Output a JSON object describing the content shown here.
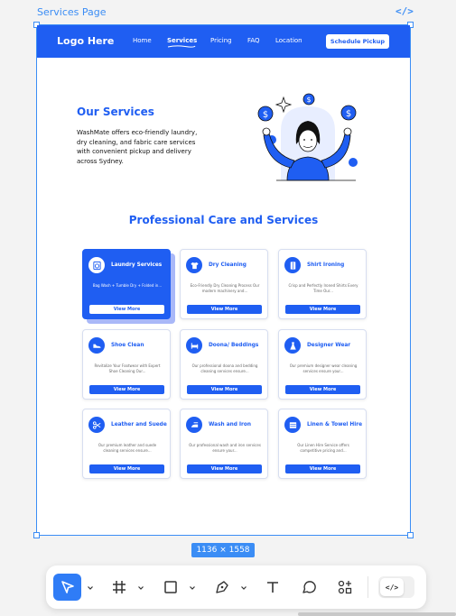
{
  "frame": {
    "label": "Services Page",
    "dev_icon": "</>",
    "size_badge": "1136 × 1558"
  },
  "site": {
    "logo": "Logo Here",
    "nav": [
      "Home",
      "Services",
      "Pricing",
      "FAQ",
      "Location"
    ],
    "active_nav": "Services",
    "cta": "Schedule Pickup",
    "hero_title": "Our Services",
    "hero_text": "WashMate offers eco-friendly laundry, dry cleaning, and fabric care services with convenient pickup and delivery across Sydney.",
    "section_title": "Professional Care and Services",
    "button_label": "View More",
    "services": [
      {
        "title": "Laundry Services",
        "desc": "Bag Wash + Tumble Dry + Folded in...",
        "icon": "laundry-icon",
        "active": true
      },
      {
        "title": "Dry Cleaning",
        "desc": "Eco-Friendly Dry Cleaning Process Our modern machinery and...",
        "icon": "shirt-icon",
        "active": false
      },
      {
        "title": "Shirt Ironing",
        "desc": "Crisp and Perfectly Ironed Shirts Every Time Our...",
        "icon": "shirt-ironing-icon",
        "active": false
      },
      {
        "title": "Shoe Clean",
        "desc": "Revitalize Your Footwear with Expert Shoe Cleaning Our...",
        "icon": "shoe-icon",
        "active": false
      },
      {
        "title": "Doona/ Beddings",
        "desc": "Our professional doona and bedding cleaning services ensure...",
        "icon": "bed-icon",
        "active": false
      },
      {
        "title": "Designer Wear",
        "desc": "Our premium designer wear cleaning services ensure your...",
        "icon": "dress-icon",
        "active": false
      },
      {
        "title": "Leather and Suede",
        "desc": "Our premium leather and suede cleaning services ensure...",
        "icon": "scissors-icon",
        "active": false
      },
      {
        "title": "Wash and Iron",
        "desc": "Our professional wash and iron services ensure your...",
        "icon": "iron-icon",
        "active": false
      },
      {
        "title": "Linen & Towel Hire",
        "desc": "Our Linen Hire Service offers competitive pricing and...",
        "icon": "towel-icon",
        "active": false
      }
    ]
  },
  "toolbar": {
    "tools": [
      "move-tool",
      "frame-tool",
      "shape-tool",
      "pen-tool",
      "text-tool",
      "comment-tool",
      "components-tool"
    ],
    "selected": "move-tool",
    "code_toggle": "</>"
  },
  "colors": {
    "brand": "#1f5ef2",
    "selection": "#3b8df5",
    "card_shadow": "#a9b8f8"
  }
}
